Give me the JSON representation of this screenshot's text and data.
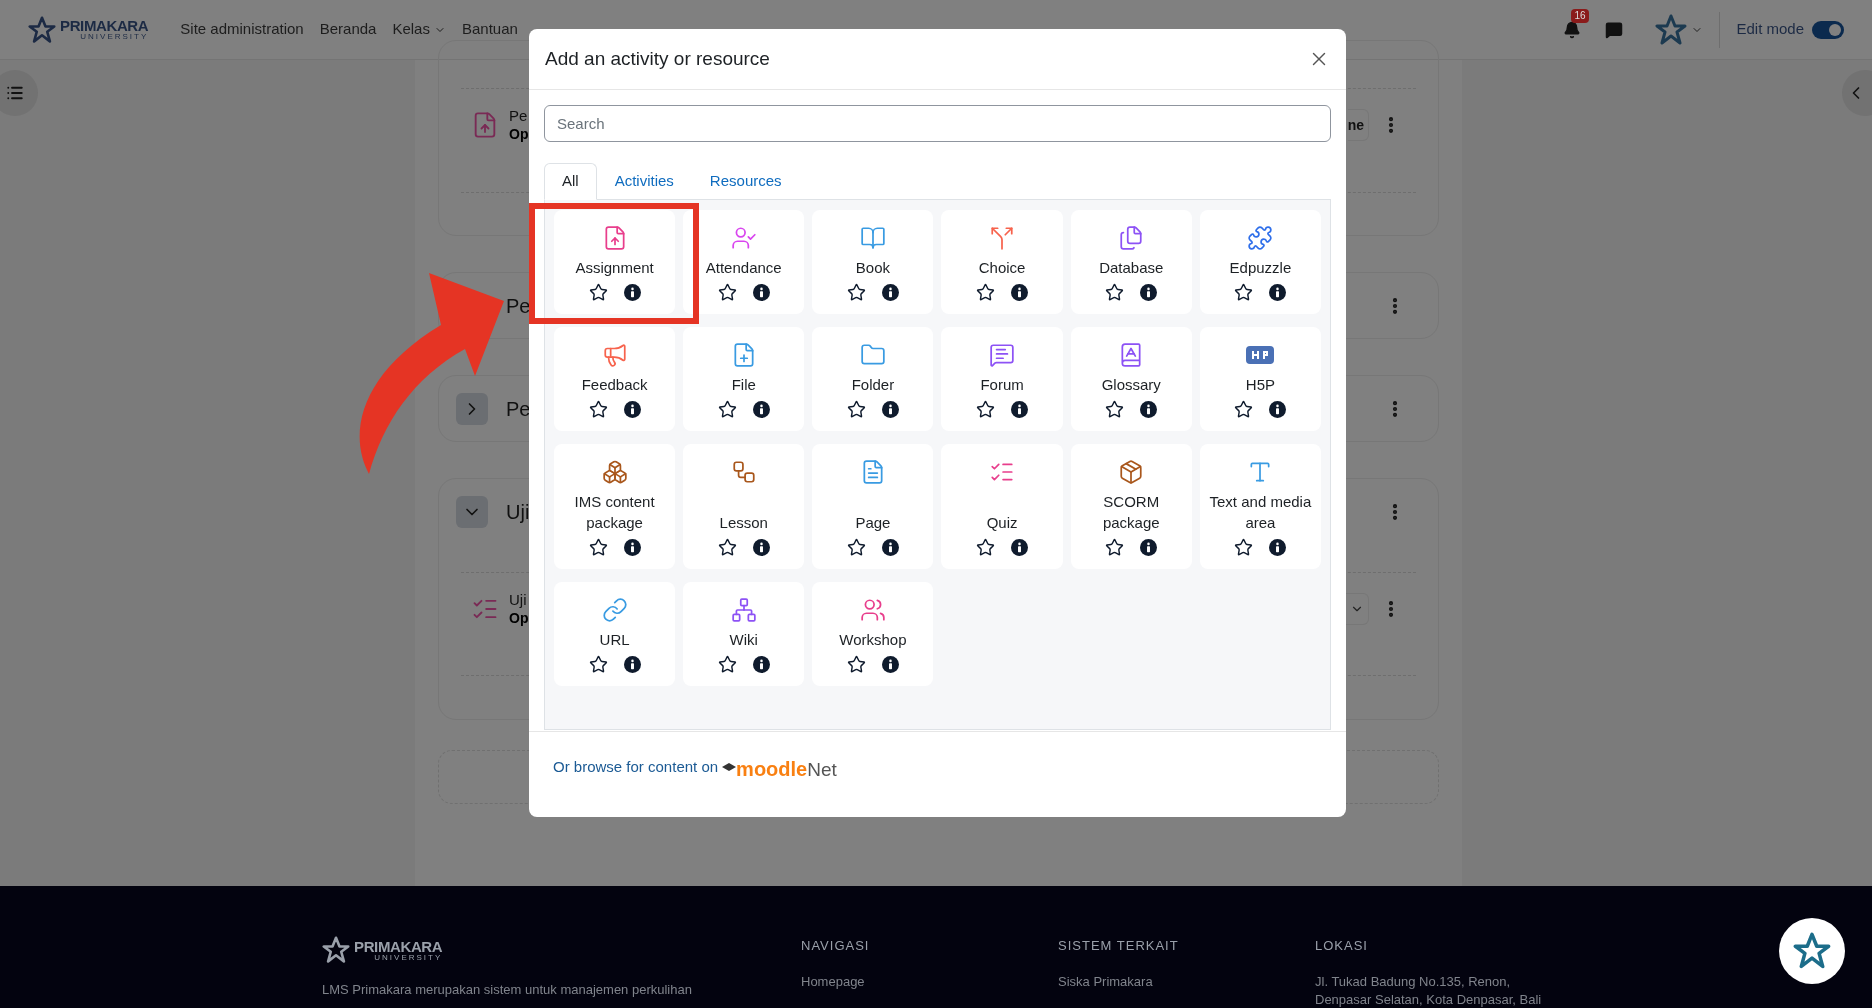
{
  "navbar": {
    "logo": {
      "name": "PRIMAKARA",
      "sub": "UNIVERSITY"
    },
    "links": [
      {
        "label": "Site administration",
        "dropdown": false
      },
      {
        "label": "Beranda",
        "dropdown": false
      },
      {
        "label": "Kelas",
        "dropdown": true
      },
      {
        "label": "Bantuan",
        "dropdown": false
      }
    ],
    "notification_count": "16",
    "edit_mode": {
      "label": "Edit mode",
      "on": true
    }
  },
  "background": {
    "items": [
      {
        "kind": "activity",
        "title": "Pe",
        "status": "Op",
        "button": "ne"
      },
      {
        "kind": "section",
        "title": "Pe"
      },
      {
        "kind": "section",
        "title": "Pe",
        "expanded": false
      },
      {
        "kind": "section",
        "title": "Uji",
        "expanded": true,
        "children": [
          {
            "kind": "activity",
            "title": "Uji",
            "status": "Op"
          }
        ]
      }
    ]
  },
  "dialog": {
    "title": "Add an activity or resource",
    "search": {
      "placeholder": "Search"
    },
    "tabs": [
      {
        "label": "All",
        "selected": true
      },
      {
        "label": "Activities",
        "selected": false
      },
      {
        "label": "Resources",
        "selected": false
      }
    ],
    "items": [
      {
        "name": "Assignment",
        "kind": "assignment",
        "color": "#e83e8c",
        "starred": false
      },
      {
        "name": "Attendance",
        "kind": "attendance",
        "color": "#d946ef",
        "starred": false
      },
      {
        "name": "Book",
        "kind": "book",
        "color": "#399be2",
        "starred": false
      },
      {
        "name": "Choice",
        "kind": "choice",
        "color": "#f7634d",
        "starred": false
      },
      {
        "name": "Database",
        "kind": "database",
        "color": "#8d52f5",
        "starred": false
      },
      {
        "name": "Edpuzzle",
        "kind": "puzzle",
        "color": "#2f6fea",
        "starred": false
      },
      {
        "name": "Feedback",
        "kind": "feedback",
        "color": "#f7634d",
        "starred": false
      },
      {
        "name": "File",
        "kind": "file",
        "color": "#399be2",
        "starred": false
      },
      {
        "name": "Folder",
        "kind": "folder",
        "color": "#399be2",
        "starred": false
      },
      {
        "name": "Forum",
        "kind": "forum",
        "color": "#8d52f5",
        "starred": false
      },
      {
        "name": "Glossary",
        "kind": "glossary",
        "color": "#8d52f5",
        "starred": false
      },
      {
        "name": "H5P",
        "kind": "h5p",
        "color": "#4a70b5",
        "starred": false
      },
      {
        "name": "IMS content package",
        "kind": "ims",
        "color": "#a9571c",
        "starred": false
      },
      {
        "name": "Lesson",
        "kind": "lesson",
        "color": "#a9571c",
        "starred": false
      },
      {
        "name": "Page",
        "kind": "page",
        "color": "#399be2",
        "starred": false
      },
      {
        "name": "Quiz",
        "kind": "quiz",
        "color": "#e83e8c",
        "starred": false
      },
      {
        "name": "SCORM package",
        "kind": "scorm",
        "color": "#a9571c",
        "starred": false
      },
      {
        "name": "Text and media area",
        "kind": "text",
        "color": "#399be2",
        "starred": false
      },
      {
        "name": "URL",
        "kind": "url",
        "color": "#399be2",
        "starred": false
      },
      {
        "name": "Wiki",
        "kind": "wiki",
        "color": "#8d52f5",
        "starred": false
      },
      {
        "name": "Workshop",
        "kind": "workshop",
        "color": "#e83e8c",
        "starred": false
      }
    ],
    "footer": {
      "text": "Or browse for content on",
      "brand_a": "moodle",
      "brand_b": "Net"
    }
  },
  "footer": {
    "logo": {
      "name": "PRIMAKARA",
      "sub": "UNIVERSITY"
    },
    "about": "LMS Primakara merupakan sistem untuk manajemen perkulihan",
    "columns": [
      {
        "heading": "NAVIGASI",
        "lines": [
          "Homepage"
        ]
      },
      {
        "heading": "SISTEM TERKAIT",
        "lines": [
          "Siska Primakara"
        ]
      },
      {
        "heading": "LOKASI",
        "lines": [
          "Jl. Tukad Badung No.135, Renon,",
          "Denpasar Selatan, Kota Denpasar, Bali"
        ]
      }
    ]
  }
}
